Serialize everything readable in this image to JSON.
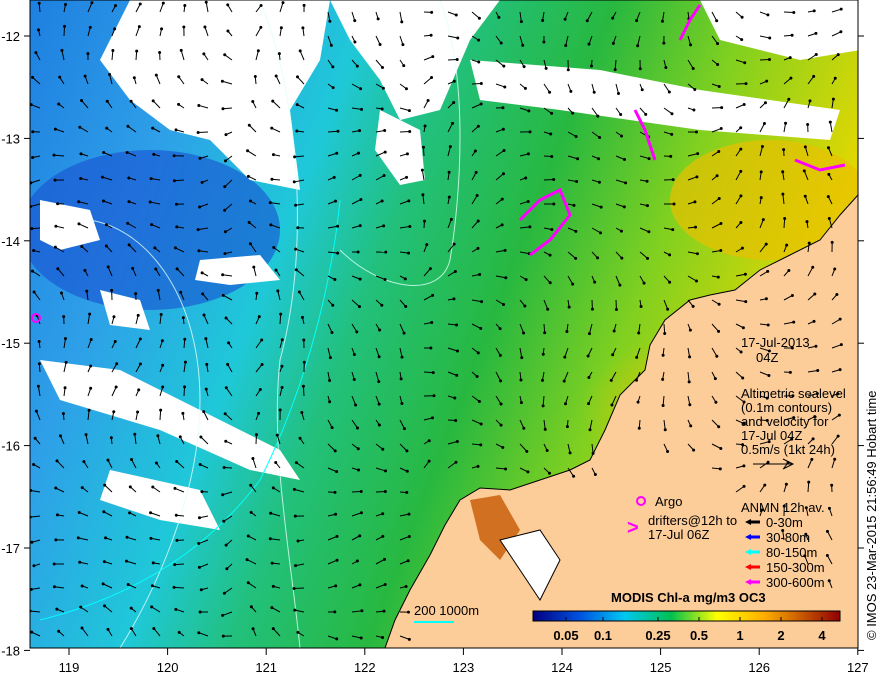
{
  "map": {
    "date": "17-Jul-2013",
    "time": "04Z",
    "altimetry_text": [
      "Altimetric sealevel",
      "(0.1m contours)",
      "and velocity for",
      "17-Jul 04Z",
      "0.5m/s (1kt 24h)"
    ],
    "argo_label": "Argo",
    "drifters_label": [
      "drifters@12h to",
      "17-Jul 06Z"
    ],
    "anmn_title": "ANMN 12h av.",
    "anmn_legend": [
      {
        "label": "0-30m",
        "color": "#000000"
      },
      {
        "label": "30-80m",
        "color": "#0000ff"
      },
      {
        "label": "80-150m",
        "color": "#00ffff"
      },
      {
        "label": "150-300m",
        "color": "#ff0000"
      },
      {
        "label": "300-600m",
        "color": "#ff00ff"
      }
    ],
    "bathymetry_label": "200  1000m",
    "colorbar_title": "MODIS Chl-a mg/m3 OC3",
    "colorbar_ticks": [
      "0.05",
      "0.1",
      "0.25",
      "0.5",
      "1",
      "2",
      "4"
    ],
    "credit": "© IMOS 23-Mar-2015 21:56:49 Hobart time",
    "x_ticks": [
      "119",
      "120",
      "121",
      "122",
      "123",
      "124",
      "125",
      "126",
      "127"
    ],
    "y_ticks": [
      "-12",
      "-13",
      "-14",
      "-15",
      "-16",
      "-17",
      "-18"
    ],
    "colors": {
      "land": "#fccc99",
      "argo": "#ff00ff",
      "drifters": "#ff00ff",
      "bathymetry_contour": "#00ffff"
    }
  }
}
